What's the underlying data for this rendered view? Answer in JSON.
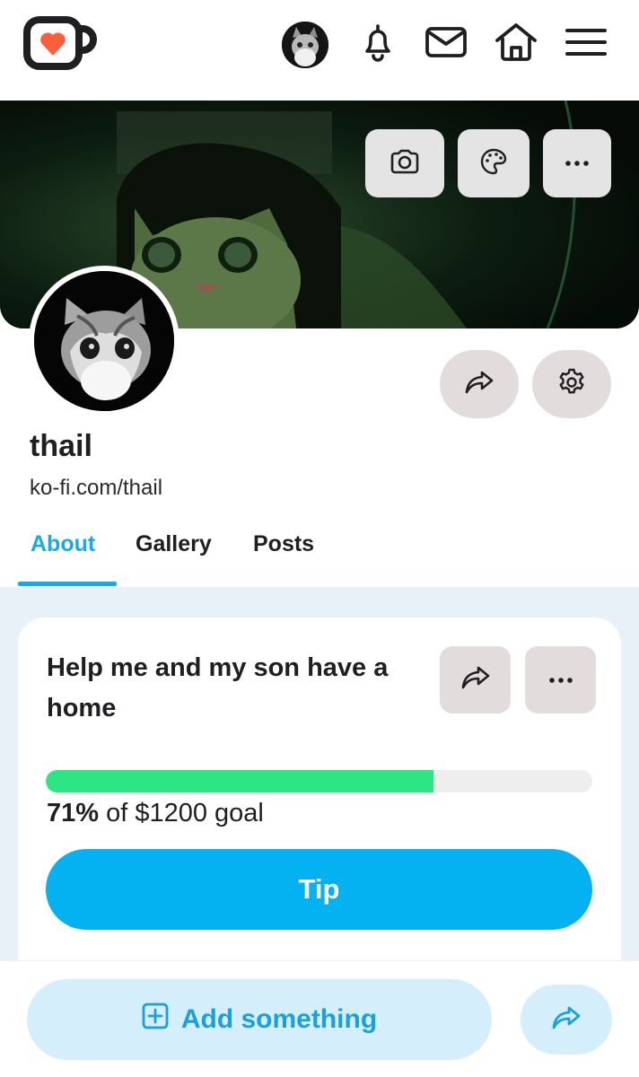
{
  "app": {
    "brand": "Ko-fi",
    "accent_color": "#1aa8e8",
    "logo_icon": "ko-fi-cup-heart-icon"
  },
  "topnav": {
    "icons": [
      "avatar",
      "bell-icon",
      "mail-icon",
      "home-icon",
      "menu-icon"
    ]
  },
  "cover": {
    "buttons": [
      "camera-icon",
      "palette-icon",
      "more-icon"
    ]
  },
  "profile": {
    "name": "thail",
    "url": "ko-fi.com/thail"
  },
  "tabs": [
    {
      "label": "About",
      "active": true
    },
    {
      "label": "Gallery",
      "active": false
    },
    {
      "label": "Posts",
      "active": false
    }
  ],
  "goal": {
    "title": "Help me and my son have a home",
    "progress_percent": 71,
    "progress_pct_text": "71%",
    "progress_rest_text": " of $1200 goal",
    "progress_color": "#2ee584",
    "tip_label": "Tip"
  },
  "bottom": {
    "add_label": "Add something"
  }
}
